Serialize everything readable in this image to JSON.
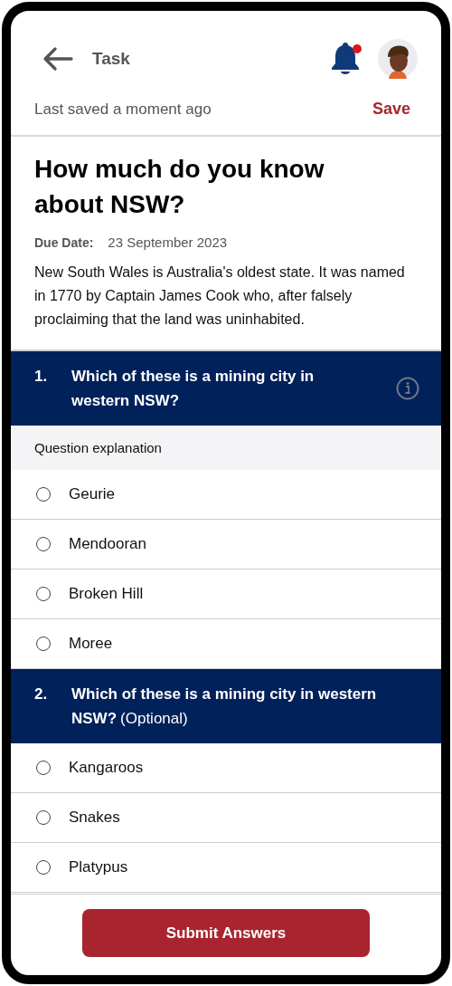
{
  "header": {
    "title": "Task",
    "notification_unread": true
  },
  "save_bar": {
    "status": "Last saved a moment ago",
    "action": "Save"
  },
  "task": {
    "title": "How much do you know about NSW?",
    "due_label": "Due Date:",
    "due_date": "23 September 2023",
    "description": "New South Wales is Australia's oldest state. It was named in 1770 by Captain James Cook who, after falsely proclaiming that the land was uninhabited."
  },
  "questions": [
    {
      "number": "1.",
      "text": "Which of these is a mining city in western NSW?",
      "has_info": true,
      "explanation": "Question explanation",
      "options": [
        {
          "label": "Geurie",
          "selected": false
        },
        {
          "label": "Mendooran",
          "selected": false
        },
        {
          "label": "Broken Hill",
          "selected": false
        },
        {
          "label": "Moree",
          "selected": false
        }
      ]
    },
    {
      "number": "2.",
      "text": "Which of these is a mining city in western NSW?",
      "optional_label": "(Optional)",
      "has_info": false,
      "options": [
        {
          "label": "Kangaroos",
          "selected": false
        },
        {
          "label": "Snakes",
          "selected": false
        },
        {
          "label": "Platypus",
          "selected": false
        }
      ]
    }
  ],
  "submit_button": "Submit Answers"
}
